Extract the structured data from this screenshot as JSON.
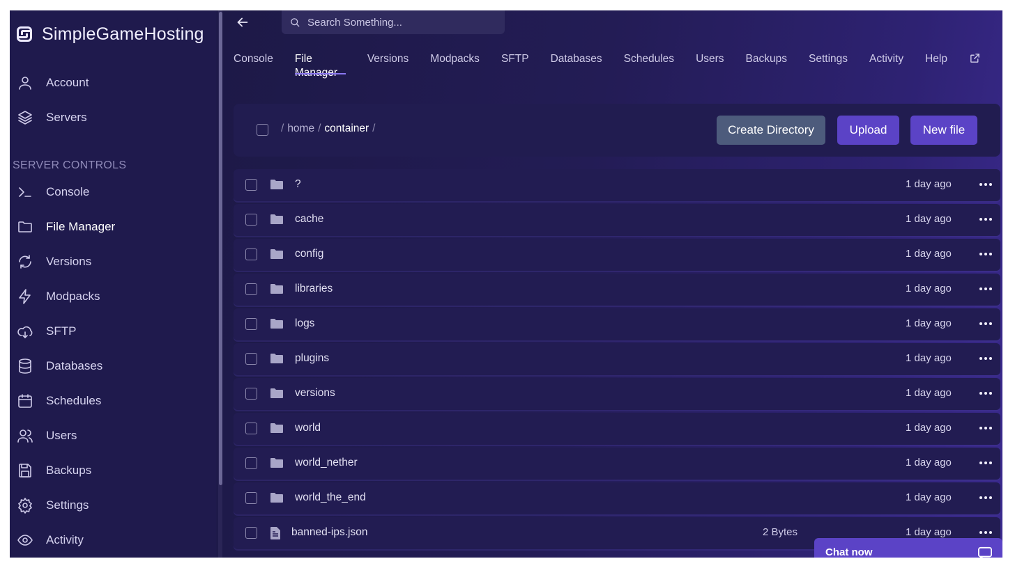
{
  "brand": {
    "name": "SimpleGameHosting"
  },
  "sidebar": {
    "top_items": [
      {
        "label": "Account",
        "icon": "user-icon"
      },
      {
        "label": "Servers",
        "icon": "layers-icon"
      }
    ],
    "section_label": "SERVER CONTROLS",
    "items": [
      {
        "label": "Console",
        "icon": "terminal-icon"
      },
      {
        "label": "File Manager",
        "icon": "folder-icon",
        "active": true
      },
      {
        "label": "Versions",
        "icon": "refresh-icon"
      },
      {
        "label": "Modpacks",
        "icon": "bolt-icon"
      },
      {
        "label": "SFTP",
        "icon": "cloud-icon"
      },
      {
        "label": "Databases",
        "icon": "database-icon"
      },
      {
        "label": "Schedules",
        "icon": "calendar-icon"
      },
      {
        "label": "Users",
        "icon": "users-icon"
      },
      {
        "label": "Backups",
        "icon": "save-icon"
      },
      {
        "label": "Settings",
        "icon": "gear-icon"
      },
      {
        "label": "Activity",
        "icon": "eye-icon"
      }
    ]
  },
  "search": {
    "placeholder": "Search Something..."
  },
  "tabs": [
    {
      "label": "Console"
    },
    {
      "label": "File Manager",
      "active": true
    },
    {
      "label": "Versions"
    },
    {
      "label": "Modpacks"
    },
    {
      "label": "SFTP"
    },
    {
      "label": "Databases"
    },
    {
      "label": "Schedules"
    },
    {
      "label": "Users"
    },
    {
      "label": "Backups"
    },
    {
      "label": "Settings"
    },
    {
      "label": "Activity"
    },
    {
      "label": "Help"
    }
  ],
  "breadcrumb": {
    "sep": "/",
    "home": "home",
    "current": "container"
  },
  "actions": {
    "create_directory": "Create Directory",
    "upload": "Upload",
    "new_file": "New file"
  },
  "files": [
    {
      "name": "?",
      "type": "folder",
      "size": "",
      "modified": "1 day ago"
    },
    {
      "name": "cache",
      "type": "folder",
      "size": "",
      "modified": "1 day ago"
    },
    {
      "name": "config",
      "type": "folder",
      "size": "",
      "modified": "1 day ago"
    },
    {
      "name": "libraries",
      "type": "folder",
      "size": "",
      "modified": "1 day ago"
    },
    {
      "name": "logs",
      "type": "folder",
      "size": "",
      "modified": "1 day ago"
    },
    {
      "name": "plugins",
      "type": "folder",
      "size": "",
      "modified": "1 day ago"
    },
    {
      "name": "versions",
      "type": "folder",
      "size": "",
      "modified": "1 day ago"
    },
    {
      "name": "world",
      "type": "folder",
      "size": "",
      "modified": "1 day ago"
    },
    {
      "name": "world_nether",
      "type": "folder",
      "size": "",
      "modified": "1 day ago"
    },
    {
      "name": "world_the_end",
      "type": "folder",
      "size": "",
      "modified": "1 day ago"
    },
    {
      "name": "banned-ips.json",
      "type": "file",
      "size": "2 Bytes",
      "modified": "1 day ago"
    }
  ],
  "chat": {
    "label": "Chat now"
  },
  "colors": {
    "accent": "#5b43c6",
    "secondary_button": "#4d5b7c",
    "sidebar_bg": "#1f1a4d"
  }
}
